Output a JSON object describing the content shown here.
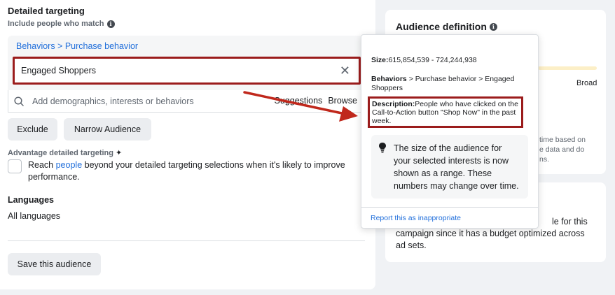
{
  "targeting": {
    "title": "Detailed targeting",
    "include_label": "Include people who match",
    "breadcrumb": "Behaviors > Purchase behavior",
    "selected_item": "Engaged Shoppers",
    "search_placeholder": "Add demographics, interests or behaviors",
    "suggestions_label": "Suggestions",
    "browse_label": "Browse",
    "exclude_label": "Exclude",
    "narrow_label": "Narrow Audience",
    "advantage_label": "Advantage detailed targeting",
    "reach_prefix": "Reach ",
    "reach_link": "people",
    "reach_suffix": " beyond your detailed targeting selections when it's likely to improve performance.",
    "languages_title": "Languages",
    "languages_value": "All languages",
    "save_label": "Save this audience"
  },
  "audience": {
    "title": "Audience definition",
    "broad_label": "Broad",
    "partial_line1": "time based on",
    "partial_line2": "e data and do",
    "partial_line3": "ns.",
    "card2_line1": "le for this",
    "card2_line2": "campaign since it has a budget optimized across",
    "card2_line3": "ad sets."
  },
  "popover": {
    "size_label": "Size:",
    "size_value": "615,854,539 - 724,244,938",
    "behaviors_label": "Behaviors",
    "behaviors_path": " > Purchase behavior > Engaged Shoppers",
    "description_label": "Description:",
    "description_text": "People who have clicked on the Call-to-Action button \"Shop Now\" in the past week.",
    "tip_text": "The size of the audience for your selected interests is now shown as a range. These numbers may change over time.",
    "report_link": "Report this as inappropriate"
  },
  "colors": {
    "highlight": "#9b1c1c",
    "link": "#216fdb",
    "arrow": "#c0281c"
  }
}
